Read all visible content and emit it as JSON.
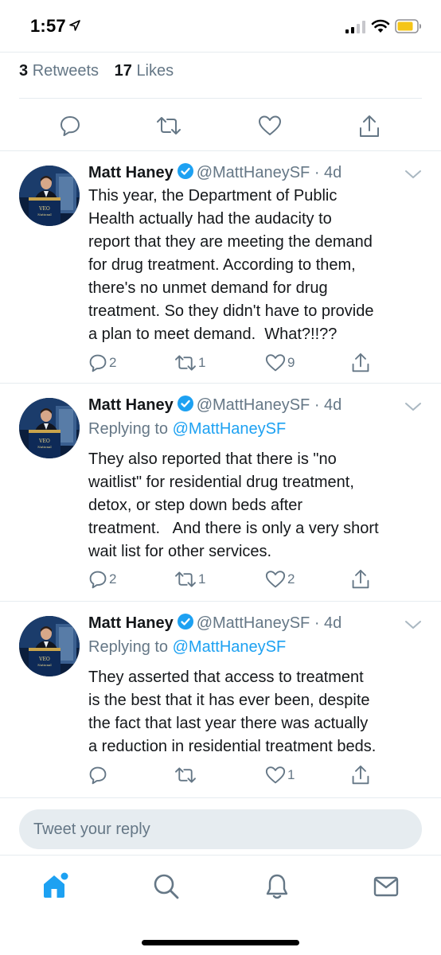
{
  "status_bar": {
    "time": "1:57"
  },
  "stats": {
    "retweets_count": "3",
    "retweets_label": "Retweets",
    "likes_count": "17",
    "likes_label": "Likes"
  },
  "colors": {
    "accent": "#1da1f2",
    "secondary_text": "#657786",
    "divider": "#e6ecf0",
    "primary_text": "#14171a"
  },
  "tweets": [
    {
      "name": "Matt Haney",
      "handle": "@MattHaneySF",
      "time": "· 4d",
      "replying_prefix": "",
      "replying_mention": "",
      "text": "This year, the Department of Public\nHealth actually had the audacity to\nreport that they are meeting the demand\nfor drug treatment. According to them,\nthere's no unmet demand for drug\ntreatment. So they didn't have to provide\na plan to meet demand.  What?!!??",
      "replies": "2",
      "retweets": "1",
      "likes": "9"
    },
    {
      "name": "Matt Haney",
      "handle": "@MattHaneySF",
      "time": "· 4d",
      "replying_prefix": "Replying to ",
      "replying_mention": "@MattHaneySF",
      "text": "They also reported that there is \"no\nwaitlist\" for residential drug treatment,\ndetox, or step down beds after\ntreatment.   And there is only a very short\nwait list for other services.",
      "replies": "2",
      "retweets": "1",
      "likes": "2"
    },
    {
      "name": "Matt Haney",
      "handle": "@MattHaneySF",
      "time": "· 4d",
      "replying_prefix": "Replying to ",
      "replying_mention": "@MattHaneySF",
      "text": "They asserted that access to treatment\nis the best that it has ever been, despite\nthe fact that last year there was actually\na reduction in residential treatment beds.",
      "replies": "",
      "retweets": "",
      "likes": "1"
    }
  ],
  "reply": {
    "placeholder": "Tweet your reply"
  },
  "icons": [
    "location-arrow-icon",
    "signal-icon",
    "wifi-icon",
    "battery-icon",
    "reply-icon",
    "retweet-icon",
    "like-icon",
    "share-icon",
    "verified-icon",
    "chevron-down-icon",
    "home-icon",
    "search-icon",
    "notifications-icon",
    "messages-icon"
  ]
}
